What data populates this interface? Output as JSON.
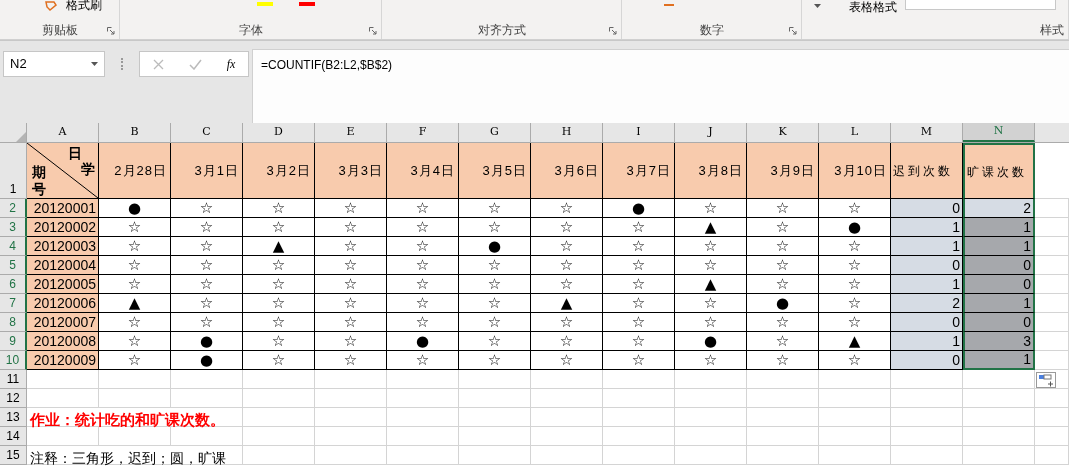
{
  "ribbon": {
    "format_painter": "格式刷",
    "table_format": "表格格式",
    "groups": [
      {
        "label": "剪贴板",
        "launcher": true
      },
      {
        "label": "字体",
        "launcher": true
      },
      {
        "label": "对齐方式",
        "launcher": true
      },
      {
        "label": "数字",
        "launcher": true
      },
      {
        "label": "样式",
        "launcher": false
      }
    ]
  },
  "formula_bar": {
    "name_box": "N2",
    "fx": "fx",
    "formula": "=COUNTIF(B2:L2,$B$2)"
  },
  "columns": [
    {
      "label": "A",
      "selected": false
    },
    {
      "label": "B",
      "selected": false
    },
    {
      "label": "C",
      "selected": false
    },
    {
      "label": "D",
      "selected": false
    },
    {
      "label": "E",
      "selected": false
    },
    {
      "label": "F",
      "selected": false
    },
    {
      "label": "G",
      "selected": false
    },
    {
      "label": "H",
      "selected": false
    },
    {
      "label": "I",
      "selected": false
    },
    {
      "label": "J",
      "selected": false
    },
    {
      "label": "K",
      "selected": false
    },
    {
      "label": "L",
      "selected": false
    },
    {
      "label": "M",
      "selected": false
    },
    {
      "label": "N",
      "selected": true
    }
  ],
  "header_row": {
    "row_number": "1",
    "corner": {
      "top": "日",
      "right": "学",
      "left": "期",
      "bottom": "号"
    },
    "dates": [
      "2月28日",
      "3月1日",
      "3月2日",
      "3月3日",
      "3月4日",
      "3月5日",
      "3月6日",
      "3月7日",
      "3月8日",
      "3月9日",
      "3月10日"
    ],
    "late_count": "迟到次数",
    "absent_count": "旷课次数"
  },
  "rows": [
    {
      "row_number": "2",
      "id": "20120001",
      "marks": [
        "●",
        "☆",
        "☆",
        "☆",
        "☆",
        "☆",
        "☆",
        "●",
        "☆",
        "☆",
        "☆"
      ],
      "late": "0",
      "absent": "2",
      "selected": true,
      "active": true
    },
    {
      "row_number": "3",
      "id": "20120002",
      "marks": [
        "☆",
        "☆",
        "☆",
        "☆",
        "☆",
        "☆",
        "☆",
        "☆",
        "▲",
        "☆",
        "●"
      ],
      "late": "1",
      "absent": "1",
      "selected": true,
      "active": false
    },
    {
      "row_number": "4",
      "id": "20120003",
      "marks": [
        "☆",
        "☆",
        "▲",
        "☆",
        "☆",
        "●",
        "☆",
        "☆",
        "☆",
        "☆",
        "☆"
      ],
      "late": "1",
      "absent": "1",
      "selected": true,
      "active": false
    },
    {
      "row_number": "5",
      "id": "20120004",
      "marks": [
        "☆",
        "☆",
        "☆",
        "☆",
        "☆",
        "☆",
        "☆",
        "☆",
        "☆",
        "☆",
        "☆"
      ],
      "late": "0",
      "absent": "0",
      "selected": true,
      "active": false
    },
    {
      "row_number": "6",
      "id": "20120005",
      "marks": [
        "☆",
        "☆",
        "☆",
        "☆",
        "☆",
        "☆",
        "☆",
        "☆",
        "▲",
        "☆",
        "☆"
      ],
      "late": "1",
      "absent": "0",
      "selected": true,
      "active": false
    },
    {
      "row_number": "7",
      "id": "20120006",
      "marks": [
        "▲",
        "☆",
        "☆",
        "☆",
        "☆",
        "☆",
        "▲",
        "☆",
        "☆",
        "●",
        "☆"
      ],
      "late": "2",
      "absent": "1",
      "selected": true,
      "active": false
    },
    {
      "row_number": "8",
      "id": "20120007",
      "marks": [
        "☆",
        "☆",
        "☆",
        "☆",
        "☆",
        "☆",
        "☆",
        "☆",
        "☆",
        "☆",
        "☆"
      ],
      "late": "0",
      "absent": "0",
      "selected": true,
      "active": false
    },
    {
      "row_number": "9",
      "id": "20120008",
      "marks": [
        "☆",
        "●",
        "☆",
        "☆",
        "●",
        "☆",
        "☆",
        "☆",
        "●",
        "☆",
        "▲"
      ],
      "late": "1",
      "absent": "3",
      "selected": true,
      "active": false
    },
    {
      "row_number": "10",
      "id": "20120009",
      "marks": [
        "☆",
        "●",
        "☆",
        "☆",
        "☆",
        "☆",
        "☆",
        "☆",
        "☆",
        "☆",
        "☆"
      ],
      "late": "0",
      "absent": "1",
      "selected": true,
      "active": false
    }
  ],
  "empty_rows": [
    "11",
    "12"
  ],
  "note_row": {
    "row_number": "13",
    "text": "作业：统计吃的和旷课次数。"
  },
  "blank_row": "14",
  "comment_row": {
    "row_number": "15",
    "text": "注释：三角形，迟到；圆，旷课"
  }
}
